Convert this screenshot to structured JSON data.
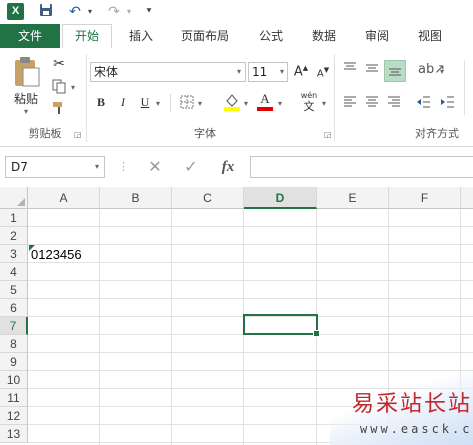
{
  "app": {
    "logo_letter": "X"
  },
  "tabs": {
    "file": "文件",
    "items": [
      {
        "label": "开始",
        "active": true
      },
      {
        "label": "插入"
      },
      {
        "label": "页面布局"
      },
      {
        "label": "公式"
      },
      {
        "label": "数据"
      },
      {
        "label": "审阅"
      },
      {
        "label": "视图"
      }
    ]
  },
  "ribbon": {
    "clipboard": {
      "paste_label": "粘贴",
      "group_label": "剪贴板"
    },
    "font": {
      "font_name": "宋体",
      "font_size": "11",
      "group_label": "字体",
      "bold": "B",
      "italic": "I",
      "underline": "U",
      "grow": "A",
      "shrink": "A",
      "font_color_letter": "A",
      "phonetic_top": "wén",
      "phonetic_bottom": "文"
    },
    "alignment": {
      "group_label": "对齐方式"
    }
  },
  "formula_bar": {
    "name_box": "D7",
    "fx": "fx",
    "cancel": "✕",
    "enter": "✓",
    "content": ""
  },
  "grid": {
    "columns": [
      "A",
      "B",
      "C",
      "D",
      "E",
      "F"
    ],
    "selected_column": "D",
    "rows": [
      "1",
      "2",
      "3",
      "4",
      "5",
      "6",
      "7",
      "8",
      "9",
      "10",
      "11",
      "12",
      "13"
    ],
    "selected_row": "7",
    "cells": {
      "A3": "0123456"
    },
    "active_cell": "D7"
  },
  "watermark": {
    "title": "易采站长站",
    "url": "www.easck.com"
  },
  "colors": {
    "accent": "#217346",
    "watermark_red": "#c0282d"
  }
}
